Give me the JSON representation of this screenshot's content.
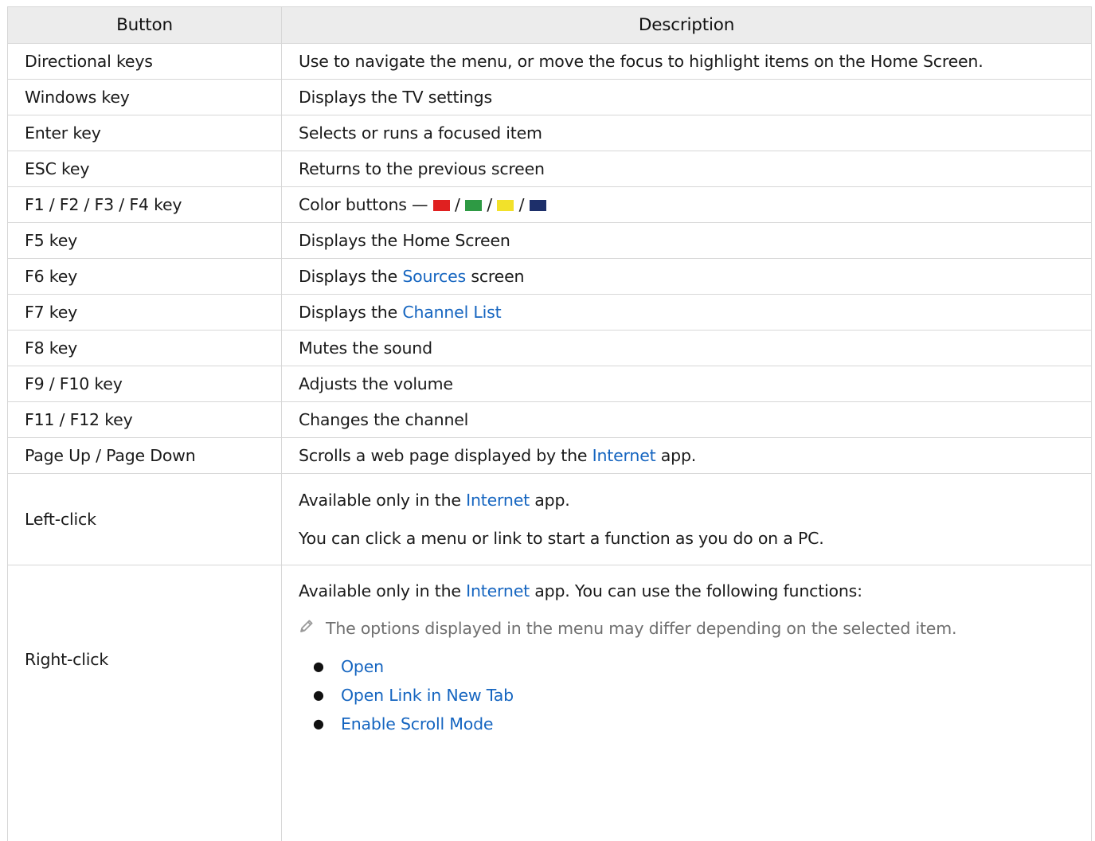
{
  "headers": {
    "button": "Button",
    "description": "Description"
  },
  "rows": [
    {
      "key": "Directional keys",
      "desc": "Use to navigate the menu, or move the focus to highlight items on the Home Screen."
    },
    {
      "key": "Windows key",
      "desc": "Displays the TV settings"
    },
    {
      "key": "Enter key",
      "desc": "Selects or runs a focused item"
    },
    {
      "key": "ESC key",
      "desc": "Returns to the previous screen"
    },
    {
      "key": "F1 / F2 / F3 / F4 key",
      "desc_prefix": "Color buttons — ",
      "separator": " / ",
      "swatches": [
        "#e02020",
        "#2e9a44",
        "#f2e12a",
        "#1d2f6a"
      ]
    },
    {
      "key": "F5 key",
      "desc": "Displays the Home Screen"
    },
    {
      "key": "F6 key",
      "desc_pre": "Displays the ",
      "desc_link": "Sources",
      "desc_post": " screen"
    },
    {
      "key": "F7 key",
      "desc_pre": "Displays the ",
      "desc_link": "Channel List"
    },
    {
      "key": "F8 key",
      "desc": "Mutes the sound"
    },
    {
      "key": "F9 / F10 key",
      "desc": "Adjusts the volume"
    },
    {
      "key": "F11 / F12 key",
      "desc": "Changes the channel"
    },
    {
      "key": "Page Up / Page Down",
      "desc_pre": "Scrolls a web page displayed by the ",
      "desc_link": "Internet",
      "desc_post": " app."
    },
    {
      "key": "Left-click",
      "p1_pre": "Available only in the ",
      "p1_link": "Internet",
      "p1_post": " app.",
      "p2": "You can click a menu or link to start a function as you do on a PC."
    },
    {
      "key": "Right-click",
      "p1_pre": "Available only in the ",
      "p1_link": "Internet",
      "p1_post": " app. You can use the following functions:",
      "note": "The options displayed in the menu may differ depending on the selected item.",
      "note_icon": "pencil-icon",
      "options": [
        "Open",
        "Open Link in New Tab",
        "Enable Scroll Mode"
      ]
    }
  ],
  "colors": {
    "link": "#1565c0",
    "header_bg": "#ececec",
    "border": "#d7d7d7",
    "note_text": "#6f6f6f"
  }
}
